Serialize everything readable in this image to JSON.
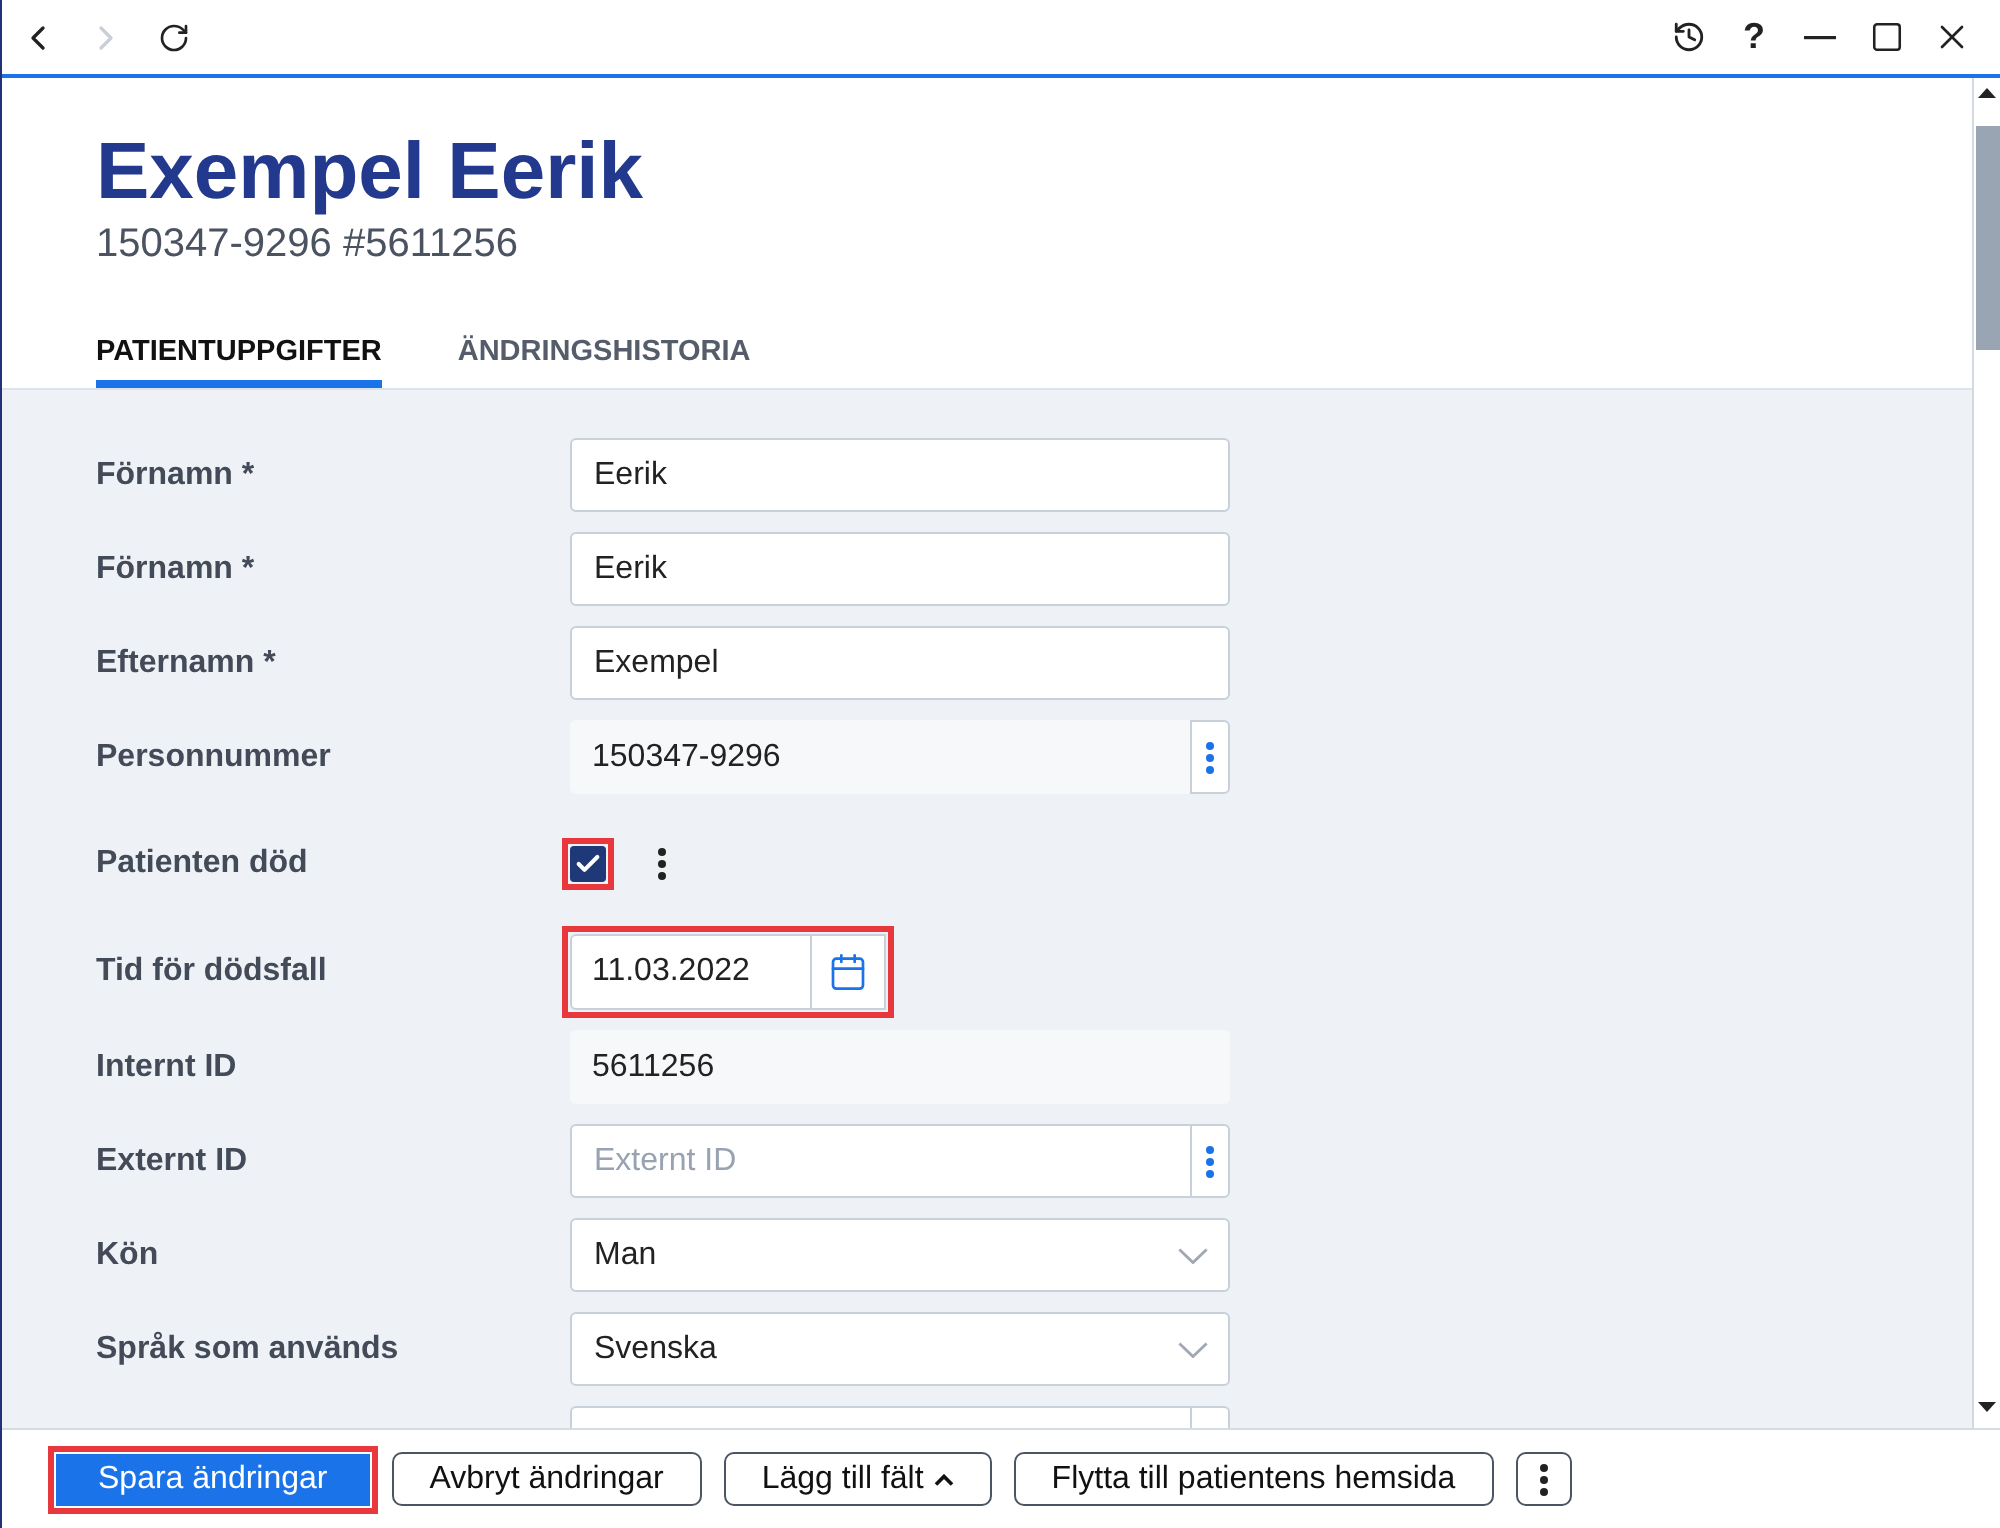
{
  "toolbar": {
    "nav": [
      {
        "kind": "back",
        "disabled": false
      },
      {
        "kind": "forward",
        "disabled": true
      },
      {
        "kind": "reload",
        "disabled": false
      }
    ],
    "help": "?"
  },
  "patient": {
    "name": "Exempel Eerik",
    "subtitle": "150347-9296 #5611256"
  },
  "tabs": [
    {
      "label": "PATIENTUPPGIFTER",
      "selected": true
    },
    {
      "label": "ÄNDRINGSHISTORIA",
      "selected": false
    }
  ],
  "fields": [
    {
      "kind": "text",
      "label": "Förnamn *",
      "value": "Eerik",
      "highlighted": false
    },
    {
      "kind": "text",
      "label": "Förnamn *",
      "value": "Eerik",
      "highlighted": false
    },
    {
      "kind": "text",
      "label": "Efternamn *",
      "value": "Exempel",
      "highlighted": false
    },
    {
      "kind": "readonly_menu",
      "label": "Personnummer",
      "value": "150347-9296",
      "highlighted": false
    },
    {
      "kind": "checkbox",
      "label": "Patienten död",
      "checked": true,
      "highlighted": true
    },
    {
      "kind": "date",
      "label": "Tid för dödsfall",
      "value": "11.03.2022",
      "highlighted": true
    },
    {
      "kind": "readonly",
      "label": "Internt ID",
      "value": "5611256",
      "highlighted": false
    },
    {
      "kind": "text_menu",
      "label": "Externt ID",
      "placeholder": "Externt ID",
      "highlighted": false
    },
    {
      "kind": "select",
      "label": "Kön",
      "value": "Man",
      "highlighted": false
    },
    {
      "kind": "select",
      "label": "Språk som används",
      "value": "Svenska",
      "highlighted": false
    },
    {
      "kind": "clipped_menu",
      "highlighted": false
    }
  ],
  "actions": [
    {
      "kind": "primary",
      "label": "Spara ändringar",
      "highlighted": true
    },
    {
      "kind": "secondary",
      "label": "Avbryt ändringar",
      "highlighted": false
    },
    {
      "kind": "dropdown",
      "label": "Lägg till fält",
      "highlighted": false
    },
    {
      "kind": "secondary",
      "label": "Flytta till patientens hemsida",
      "highlighted": false
    },
    {
      "kind": "more",
      "highlighted": false
    }
  ]
}
